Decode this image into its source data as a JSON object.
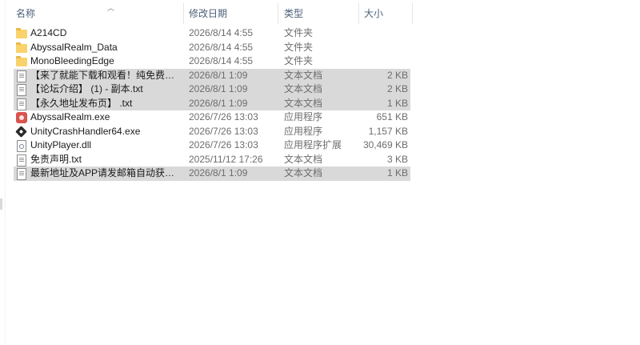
{
  "columns": {
    "name": "名称",
    "date": "修改日期",
    "type": "类型",
    "size": "大小"
  },
  "files": [
    {
      "name": "A214CD",
      "date": "2026/8/14 4:55",
      "type": "文件夹",
      "size": "",
      "icon": "folder-icon",
      "selected": false
    },
    {
      "name": "AbyssalRealm_Data",
      "date": "2026/8/14 4:55",
      "type": "文件夹",
      "size": "",
      "icon": "folder-icon",
      "selected": false
    },
    {
      "name": "MonoBleedingEdge",
      "date": "2026/8/14 4:55",
      "type": "文件夹",
      "size": "",
      "icon": "folder-icon",
      "selected": false
    },
    {
      "name": "【来了就能下载和观看！纯免费！】 - 副...",
      "date": "2026/8/1 1:09",
      "type": "文本文档",
      "size": "2 KB",
      "icon": "text-file-icon",
      "selected": true
    },
    {
      "name": "【论坛介绍】 (1) - 副本.txt",
      "date": "2026/8/1 1:09",
      "type": "文本文档",
      "size": "2 KB",
      "icon": "text-file-icon",
      "selected": true
    },
    {
      "name": "【永久地址发布页】 .txt",
      "date": "2026/8/1 1:09",
      "type": "文本文档",
      "size": "1 KB",
      "icon": "text-file-icon",
      "selected": true
    },
    {
      "name": "AbyssalRealm.exe",
      "date": "2026/7/26 13:03",
      "type": "应用程序",
      "size": "651 KB",
      "icon": "app-exe-icon",
      "selected": false
    },
    {
      "name": "UnityCrashHandler64.exe",
      "date": "2026/7/26 13:03",
      "type": "应用程序",
      "size": "1,157 KB",
      "icon": "unity-icon",
      "selected": false
    },
    {
      "name": "UnityPlayer.dll",
      "date": "2026/7/26 13:03",
      "type": "应用程序扩展",
      "size": "30,469 KB",
      "icon": "dll-icon",
      "selected": false
    },
    {
      "name": "免责声明.txt",
      "date": "2025/11/12 17:26",
      "type": "文本文档",
      "size": "3 KB",
      "icon": "text-file-icon",
      "selected": false
    },
    {
      "name": "最新地址及APP请发邮箱自动获取！！！...",
      "date": "2026/8/1 1:09",
      "type": "文本文档",
      "size": "1 KB",
      "icon": "text-file-icon",
      "selected": true
    }
  ]
}
